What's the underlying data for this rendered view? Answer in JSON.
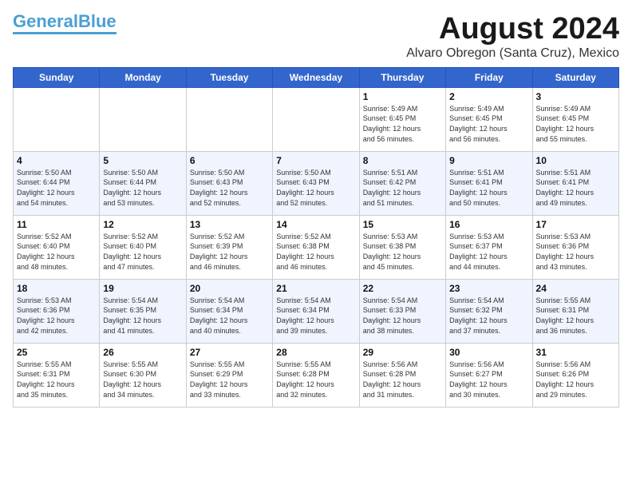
{
  "logo": {
    "part1": "General",
    "part2": "Blue"
  },
  "header": {
    "title": "August 2024",
    "subtitle": "Alvaro Obregon (Santa Cruz), Mexico"
  },
  "days_of_week": [
    "Sunday",
    "Monday",
    "Tuesday",
    "Wednesday",
    "Thursday",
    "Friday",
    "Saturday"
  ],
  "weeks": [
    [
      {
        "day": "",
        "info": ""
      },
      {
        "day": "",
        "info": ""
      },
      {
        "day": "",
        "info": ""
      },
      {
        "day": "",
        "info": ""
      },
      {
        "day": "1",
        "info": "Sunrise: 5:49 AM\nSunset: 6:45 PM\nDaylight: 12 hours\nand 56 minutes."
      },
      {
        "day": "2",
        "info": "Sunrise: 5:49 AM\nSunset: 6:45 PM\nDaylight: 12 hours\nand 56 minutes."
      },
      {
        "day": "3",
        "info": "Sunrise: 5:49 AM\nSunset: 6:45 PM\nDaylight: 12 hours\nand 55 minutes."
      }
    ],
    [
      {
        "day": "4",
        "info": "Sunrise: 5:50 AM\nSunset: 6:44 PM\nDaylight: 12 hours\nand 54 minutes."
      },
      {
        "day": "5",
        "info": "Sunrise: 5:50 AM\nSunset: 6:44 PM\nDaylight: 12 hours\nand 53 minutes."
      },
      {
        "day": "6",
        "info": "Sunrise: 5:50 AM\nSunset: 6:43 PM\nDaylight: 12 hours\nand 52 minutes."
      },
      {
        "day": "7",
        "info": "Sunrise: 5:50 AM\nSunset: 6:43 PM\nDaylight: 12 hours\nand 52 minutes."
      },
      {
        "day": "8",
        "info": "Sunrise: 5:51 AM\nSunset: 6:42 PM\nDaylight: 12 hours\nand 51 minutes."
      },
      {
        "day": "9",
        "info": "Sunrise: 5:51 AM\nSunset: 6:41 PM\nDaylight: 12 hours\nand 50 minutes."
      },
      {
        "day": "10",
        "info": "Sunrise: 5:51 AM\nSunset: 6:41 PM\nDaylight: 12 hours\nand 49 minutes."
      }
    ],
    [
      {
        "day": "11",
        "info": "Sunrise: 5:52 AM\nSunset: 6:40 PM\nDaylight: 12 hours\nand 48 minutes."
      },
      {
        "day": "12",
        "info": "Sunrise: 5:52 AM\nSunset: 6:40 PM\nDaylight: 12 hours\nand 47 minutes."
      },
      {
        "day": "13",
        "info": "Sunrise: 5:52 AM\nSunset: 6:39 PM\nDaylight: 12 hours\nand 46 minutes."
      },
      {
        "day": "14",
        "info": "Sunrise: 5:52 AM\nSunset: 6:38 PM\nDaylight: 12 hours\nand 46 minutes."
      },
      {
        "day": "15",
        "info": "Sunrise: 5:53 AM\nSunset: 6:38 PM\nDaylight: 12 hours\nand 45 minutes."
      },
      {
        "day": "16",
        "info": "Sunrise: 5:53 AM\nSunset: 6:37 PM\nDaylight: 12 hours\nand 44 minutes."
      },
      {
        "day": "17",
        "info": "Sunrise: 5:53 AM\nSunset: 6:36 PM\nDaylight: 12 hours\nand 43 minutes."
      }
    ],
    [
      {
        "day": "18",
        "info": "Sunrise: 5:53 AM\nSunset: 6:36 PM\nDaylight: 12 hours\nand 42 minutes."
      },
      {
        "day": "19",
        "info": "Sunrise: 5:54 AM\nSunset: 6:35 PM\nDaylight: 12 hours\nand 41 minutes."
      },
      {
        "day": "20",
        "info": "Sunrise: 5:54 AM\nSunset: 6:34 PM\nDaylight: 12 hours\nand 40 minutes."
      },
      {
        "day": "21",
        "info": "Sunrise: 5:54 AM\nSunset: 6:34 PM\nDaylight: 12 hours\nand 39 minutes."
      },
      {
        "day": "22",
        "info": "Sunrise: 5:54 AM\nSunset: 6:33 PM\nDaylight: 12 hours\nand 38 minutes."
      },
      {
        "day": "23",
        "info": "Sunrise: 5:54 AM\nSunset: 6:32 PM\nDaylight: 12 hours\nand 37 minutes."
      },
      {
        "day": "24",
        "info": "Sunrise: 5:55 AM\nSunset: 6:31 PM\nDaylight: 12 hours\nand 36 minutes."
      }
    ],
    [
      {
        "day": "25",
        "info": "Sunrise: 5:55 AM\nSunset: 6:31 PM\nDaylight: 12 hours\nand 35 minutes."
      },
      {
        "day": "26",
        "info": "Sunrise: 5:55 AM\nSunset: 6:30 PM\nDaylight: 12 hours\nand 34 minutes."
      },
      {
        "day": "27",
        "info": "Sunrise: 5:55 AM\nSunset: 6:29 PM\nDaylight: 12 hours\nand 33 minutes."
      },
      {
        "day": "28",
        "info": "Sunrise: 5:55 AM\nSunset: 6:28 PM\nDaylight: 12 hours\nand 32 minutes."
      },
      {
        "day": "29",
        "info": "Sunrise: 5:56 AM\nSunset: 6:28 PM\nDaylight: 12 hours\nand 31 minutes."
      },
      {
        "day": "30",
        "info": "Sunrise: 5:56 AM\nSunset: 6:27 PM\nDaylight: 12 hours\nand 30 minutes."
      },
      {
        "day": "31",
        "info": "Sunrise: 5:56 AM\nSunset: 6:26 PM\nDaylight: 12 hours\nand 29 minutes."
      }
    ]
  ]
}
